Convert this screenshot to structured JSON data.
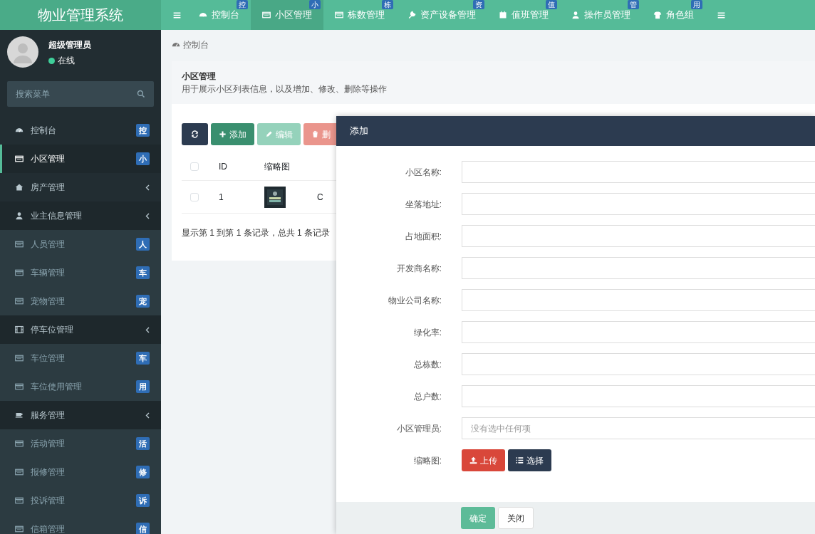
{
  "header": {
    "logo": "物业管理系统",
    "tabs": [
      {
        "label": "控制台",
        "kind": "gauge",
        "badge": "控",
        "selected": false
      },
      {
        "label": "小区管理",
        "kind": "list",
        "badge": "小",
        "selected": true
      },
      {
        "label": "栋数管理",
        "kind": "list",
        "badge": "栋",
        "selected": false
      },
      {
        "label": "资产设备管理",
        "kind": "wrench",
        "badge": "资",
        "selected": false
      },
      {
        "label": "值班管理",
        "kind": "calendar",
        "badge": "值",
        "selected": false
      },
      {
        "label": "操作员管理",
        "kind": "user",
        "badge": "管",
        "selected": false
      },
      {
        "label": "角色组",
        "kind": "group",
        "badge": "用",
        "selected": false
      }
    ]
  },
  "sidebar": {
    "user": {
      "name": "超级管理员",
      "status": "在线"
    },
    "search": {
      "placeholder": "搜索菜单"
    },
    "items": [
      {
        "label": "控制台",
        "kind": "gauge",
        "badge": "控",
        "selected": false
      },
      {
        "label": "小区管理",
        "kind": "list",
        "badge": "小",
        "selected": true
      },
      {
        "label": "房产管理",
        "kind": "home",
        "selected": false
      },
      {
        "label": "业主信息管理",
        "kind": "user",
        "selected": false,
        "children": [
          {
            "label": "人员管理",
            "kind": "list",
            "badge": "人",
            "selected": false
          },
          {
            "label": "车辆管理",
            "kind": "list",
            "badge": "车",
            "selected": false
          },
          {
            "label": "宠物管理",
            "kind": "list",
            "badge": "宠",
            "selected": false
          }
        ]
      },
      {
        "label": "停车位管理",
        "kind": "film",
        "selected": false,
        "children": [
          {
            "label": "车位管理",
            "kind": "list",
            "badge": "车",
            "selected": false
          },
          {
            "label": "车位使用管理",
            "kind": "list",
            "badge": "用",
            "selected": false
          }
        ]
      },
      {
        "label": "服务管理",
        "kind": "cup",
        "selected": false,
        "children": [
          {
            "label": "活动管理",
            "kind": "list",
            "badge": "活",
            "selected": false
          },
          {
            "label": "报修管理",
            "kind": "list",
            "badge": "修",
            "selected": false
          },
          {
            "label": "投诉管理",
            "kind": "list",
            "badge": "诉",
            "selected": false
          },
          {
            "label": "信箱管理",
            "kind": "list",
            "badge": "信",
            "selected": false
          }
        ]
      }
    ]
  },
  "breadcrumb": "控制台",
  "panel": {
    "title": "小区管理",
    "description": "用于展示小区列表信息，以及增加、修改、删除等操作",
    "toolbar": [
      {
        "kind": "refresh"
      },
      {
        "kind": "add",
        "label": "添加"
      },
      {
        "kind": "edit",
        "label": "编辑",
        "disabled": true
      },
      {
        "kind": "delete",
        "label": "删",
        "disabled": true
      }
    ],
    "table": {
      "select_all_checked": false,
      "columns": [
        "ID",
        "缩略图"
      ],
      "rows": [
        {
          "checked": false,
          "id": "1",
          "kind": "picture",
          "column_3": "C"
        }
      ]
    },
    "pagination_info": "显示第 1 到第 1 条记录，总共 1 条记录"
  },
  "modal": {
    "title": "添加",
    "fields": [
      {
        "label": "小区名称:",
        "kind": "text"
      },
      {
        "label": "坐落地址:",
        "kind": "text"
      },
      {
        "label": "占地面积:",
        "kind": "text"
      },
      {
        "label": "开发商名称:",
        "kind": "text"
      },
      {
        "label": "物业公司名称:",
        "kind": "text"
      },
      {
        "label": "绿化率:",
        "kind": "text"
      },
      {
        "label": "总栋数:",
        "kind": "text"
      },
      {
        "label": "总户数:",
        "kind": "text"
      },
      {
        "label": "小区管理员:",
        "kind": "select",
        "placeholder": "没有选中任何项"
      },
      {
        "label": "缩略图:",
        "kind": "upload",
        "buttons": [
          {
            "kind": "upload",
            "label": "上传"
          },
          {
            "kind": "choose",
            "label": "选择"
          }
        ]
      }
    ],
    "footer_buttons": [
      {
        "kind": "primary",
        "label": "确定"
      },
      {
        "kind": "default",
        "label": "关闭"
      }
    ]
  }
}
